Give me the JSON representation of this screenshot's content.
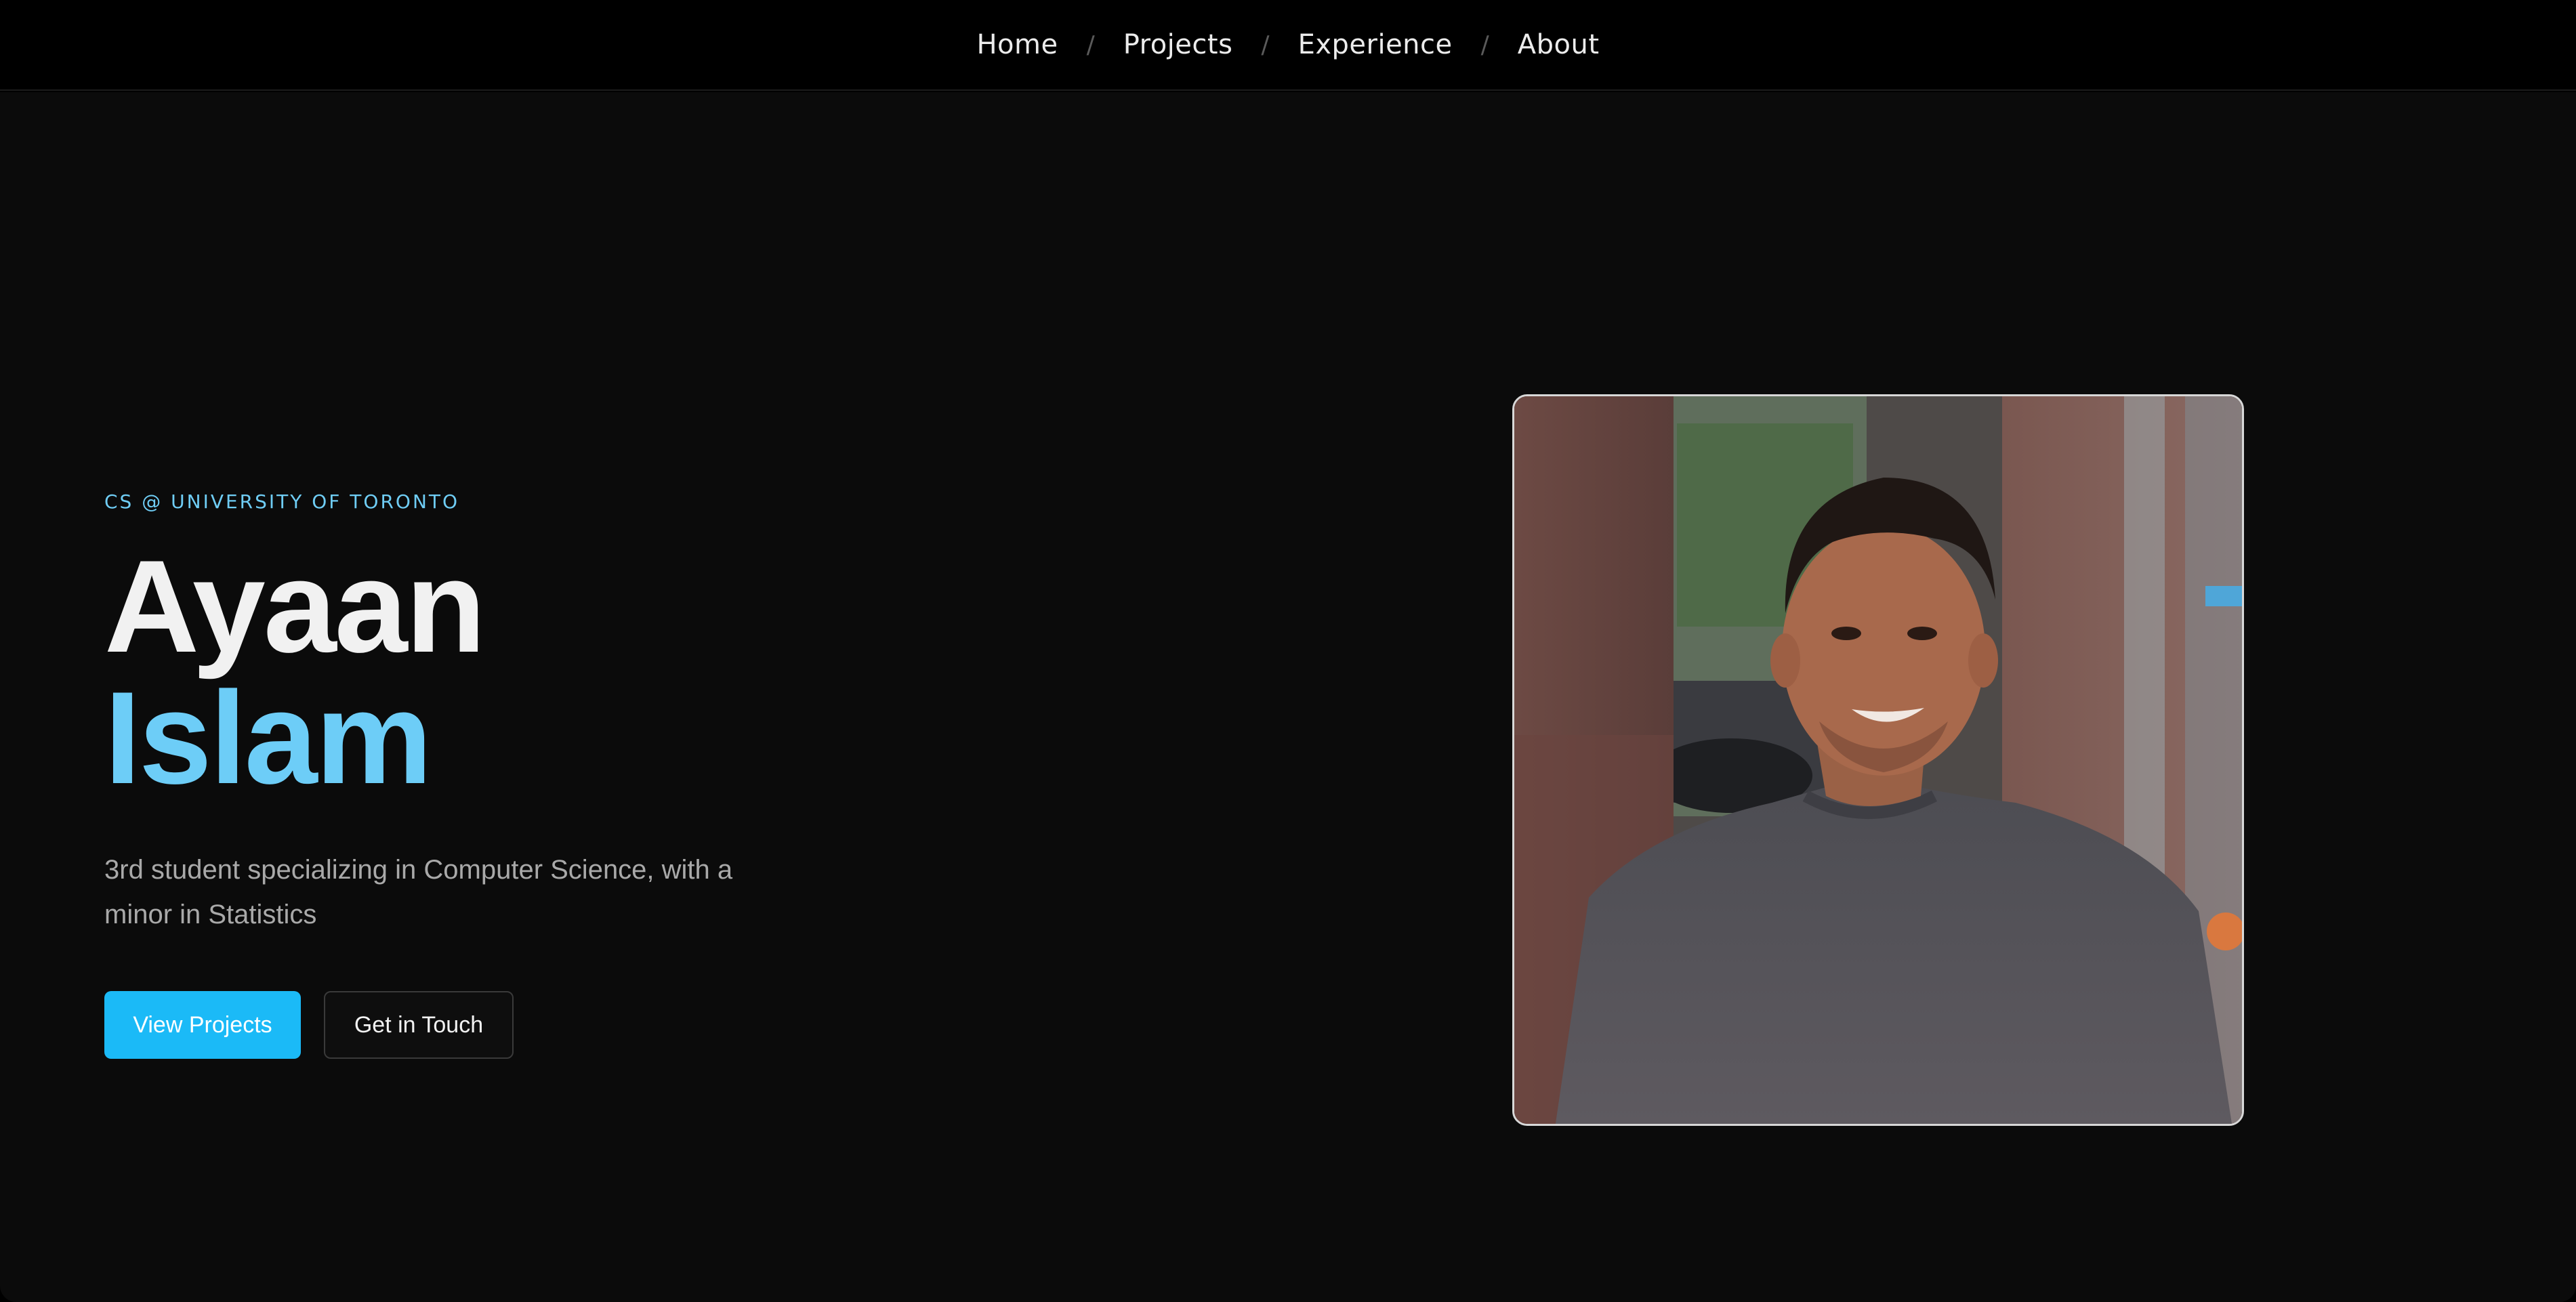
{
  "nav": {
    "items": [
      {
        "label": "Home"
      },
      {
        "label": "Projects"
      },
      {
        "label": "Experience"
      },
      {
        "label": "About"
      }
    ],
    "separator": "/"
  },
  "hero": {
    "eyebrow": "CS @ UNIVERSITY OF TORONTO",
    "first_name": "Ayaan",
    "last_name": "Islam",
    "tagline": "3rd student specializing in Computer Science, with a minor in Statistics",
    "primary_button": "View Projects",
    "secondary_button": "Get in Touch"
  },
  "photo": {
    "subject": "portrait-photo"
  },
  "colors": {
    "accent": "#6dcdf7",
    "primary_button": "#1bbaf7",
    "background": "#0b0b0b",
    "nav_background": "#000000"
  }
}
